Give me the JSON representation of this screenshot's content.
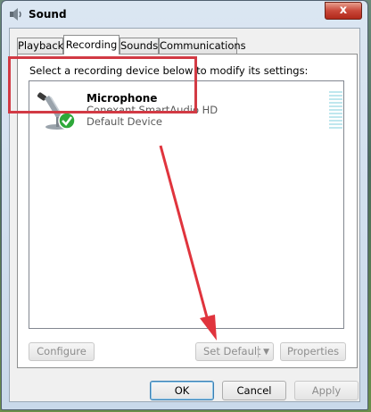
{
  "window": {
    "title": "Sound",
    "close_label": "x"
  },
  "tabs": [
    {
      "label": "Playback"
    },
    {
      "label": "Recording"
    },
    {
      "label": "Sounds"
    },
    {
      "label": "Communications"
    }
  ],
  "recording": {
    "instruction": "Select a recording device below to modify its settings:",
    "devices": [
      {
        "name": "Microphone",
        "description": "Conexant SmartAudio HD",
        "status": "Default Device",
        "icon": "microphone-icon",
        "badge_icon": "check-icon"
      }
    ],
    "buttons": {
      "configure": "Configure",
      "set_default": "Set Default",
      "properties": "Properties"
    }
  },
  "footer": {
    "ok": "OK",
    "cancel": "Cancel",
    "apply": "Apply"
  },
  "annotation": {
    "highlight_color": "#d23a44",
    "arrow_color": "#e0343d"
  }
}
